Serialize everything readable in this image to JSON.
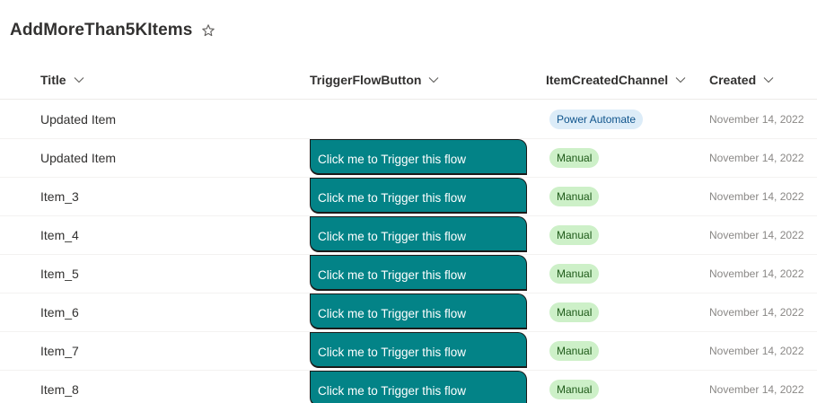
{
  "list": {
    "title": "AddMoreThan5KItems"
  },
  "columns": {
    "title": "Title",
    "trigger": "TriggerFlowButton",
    "channel": "ItemCreatedChannel",
    "created": "Created"
  },
  "rows": [
    {
      "title": "Updated Item",
      "button": "",
      "channel": "Power Automate",
      "created": "November 14, 2022"
    },
    {
      "title": "Updated Item",
      "button": "Click me to Trigger this flow",
      "channel": "Manual",
      "created": "November 14, 2022"
    },
    {
      "title": "Item_3",
      "button": "Click me to Trigger this flow",
      "channel": "Manual",
      "created": "November 14, 2022"
    },
    {
      "title": "Item_4",
      "button": "Click me to Trigger this flow",
      "channel": "Manual",
      "created": "November 14, 2022"
    },
    {
      "title": "Item_5",
      "button": "Click me to Trigger this flow",
      "channel": "Manual",
      "created": "November 14, 2022"
    },
    {
      "title": "Item_6",
      "button": "Click me to Trigger this flow",
      "channel": "Manual",
      "created": "November 14, 2022"
    },
    {
      "title": "Item_7",
      "button": "Click me to Trigger this flow",
      "channel": "Manual",
      "created": "November 14, 2022"
    },
    {
      "title": "Item_8",
      "button": "Click me to Trigger this flow",
      "channel": "Manual",
      "created": "November 14, 2022"
    }
  ],
  "icons": {
    "favorite": "star-outline-icon",
    "sort": "chevron-down-icon"
  },
  "colors": {
    "button_bg": "#038387",
    "pill_power_automate_bg": "#dcecf8",
    "pill_manual_bg": "#cdf0c8"
  }
}
